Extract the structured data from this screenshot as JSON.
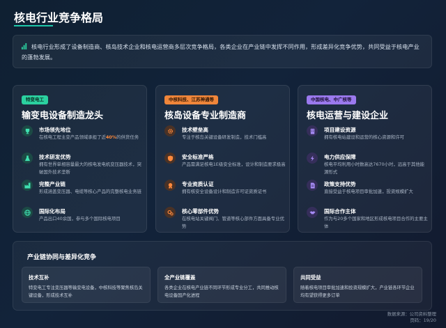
{
  "page": {
    "title": "核电行业竞争格局",
    "intro": "核电行业形成了设备制造商、核岛技术企业和核电运营商多层次竞争格局，各类企业在产业链中发挥不同作用，形成差异化竞争优势，共同受益于核电产业的蓬勃发展。"
  },
  "cards": [
    {
      "tag": "特变电工",
      "title": "输变电设备制造龙头",
      "items": [
        {
          "icon": "trophy-icon",
          "title": "市场领先地位",
          "desc_pre": "在核电工程主变产品领域承担了近",
          "desc_hl": "40%",
          "desc_post": "的供货任务"
        },
        {
          "icon": "flask-icon",
          "title": "技术研发优势",
          "desc": "拥有世界单相容量最大的核电发电机变压器技术，突破国外技术垄断"
        },
        {
          "icon": "factory-icon",
          "title": "完整产业链",
          "desc": "形成涵盖变压器、电缆等核心产品的完整核电业务链"
        },
        {
          "icon": "globe-icon",
          "title": "国际化布局",
          "desc": "产品出口40余国，参与多个国际核电项目"
        }
      ]
    },
    {
      "tag": "中核科技、江苏神通等",
      "title": "核岛设备专业制造商",
      "items": [
        {
          "icon": "gear-icon",
          "title": "技术壁垒高",
          "desc": "专注于核岛关键设备研发制造，技术门槛高"
        },
        {
          "icon": "shield-icon",
          "title": "安全标准严格",
          "desc": "产品需满足核电1E级安全标准，设计和制造要求极高"
        },
        {
          "icon": "certificate-icon",
          "title": "专业资质认证",
          "desc": "拥有核安全设备设计和制造许可证资质证书"
        },
        {
          "icon": "cogs-icon",
          "title": "核心零部件优势",
          "desc": "在核电站关键阀门、管道等核心部件方面具备专业优势"
        }
      ]
    },
    {
      "tag": "中国核电、中广核等",
      "title": "核电运营与建设企业",
      "items": [
        {
          "icon": "building-icon",
          "title": "项目建设资源",
          "desc": "拥有核电站建设和运营的核心资源和许可"
        },
        {
          "icon": "bolt-icon",
          "title": "电力供应保障",
          "desc": "核电平均利用小时数高达7670小时，远高于其他能源形式"
        },
        {
          "icon": "document-icon",
          "title": "政策支持优势",
          "desc": "直接受益于核电项目审批加速，投资规模扩大"
        },
        {
          "icon": "handshake-icon",
          "title": "国际合作主体",
          "desc": "作为与20多个国家和地区形成核电项目合作的主要主体"
        }
      ]
    }
  ],
  "synergy": {
    "title": "产业链协同与差异化竞争",
    "blocks": [
      {
        "title": "技术互补",
        "desc": "特变电工专注变压器等输变电设备，中核科技等聚焦核岛关键设备，形成技术互补"
      },
      {
        "title": "全产业链覆盖",
        "desc": "各类企业在核电产业链不同环节形成专业分工，共同推动核电设备国产化进程"
      },
      {
        "title": "共同受益",
        "desc": "随着核电项目审批加速和投资规模扩大，产业链各环节企业均有望获得更多订单"
      }
    ]
  },
  "footer": {
    "source": "数据来源：公司资料整理",
    "page": "页码：19/20"
  },
  "colors": {
    "accent_green": "#2bd1a0",
    "accent_orange": "#f0863a",
    "accent_purple": "#9b79ee",
    "highlight": "#ff8a3d"
  }
}
